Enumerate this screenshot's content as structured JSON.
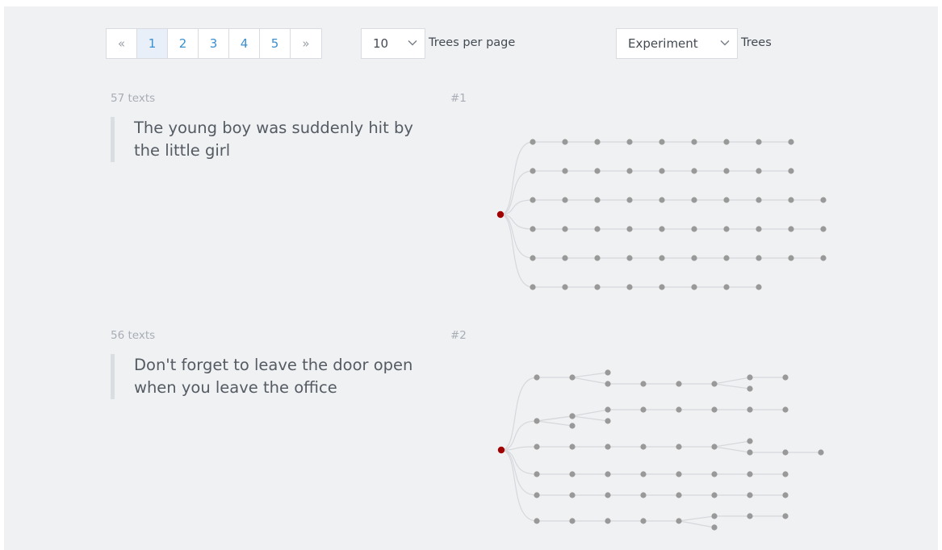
{
  "pagination": {
    "prev_label": "«",
    "pages": [
      "1",
      "2",
      "3",
      "4",
      "5"
    ],
    "active_page": "1",
    "next_label": "»"
  },
  "per_page": {
    "value": "10",
    "label": "Trees per page"
  },
  "tree_filter": {
    "value": "Experiment",
    "label": "Trees"
  },
  "trees": [
    {
      "count_label": "57 texts",
      "id_label": "#1",
      "text": "The young boy was suddenly hit by the little girl"
    },
    {
      "count_label": "56 texts",
      "id_label": "#2",
      "text": "Don't forget to leave the door open when you leave the office"
    }
  ],
  "colors": {
    "root_node": "#a00000",
    "node": "#999999",
    "edge": "#d6d8dc",
    "link": "#3a8fd0",
    "panel_bg": "#f0f1f3"
  }
}
